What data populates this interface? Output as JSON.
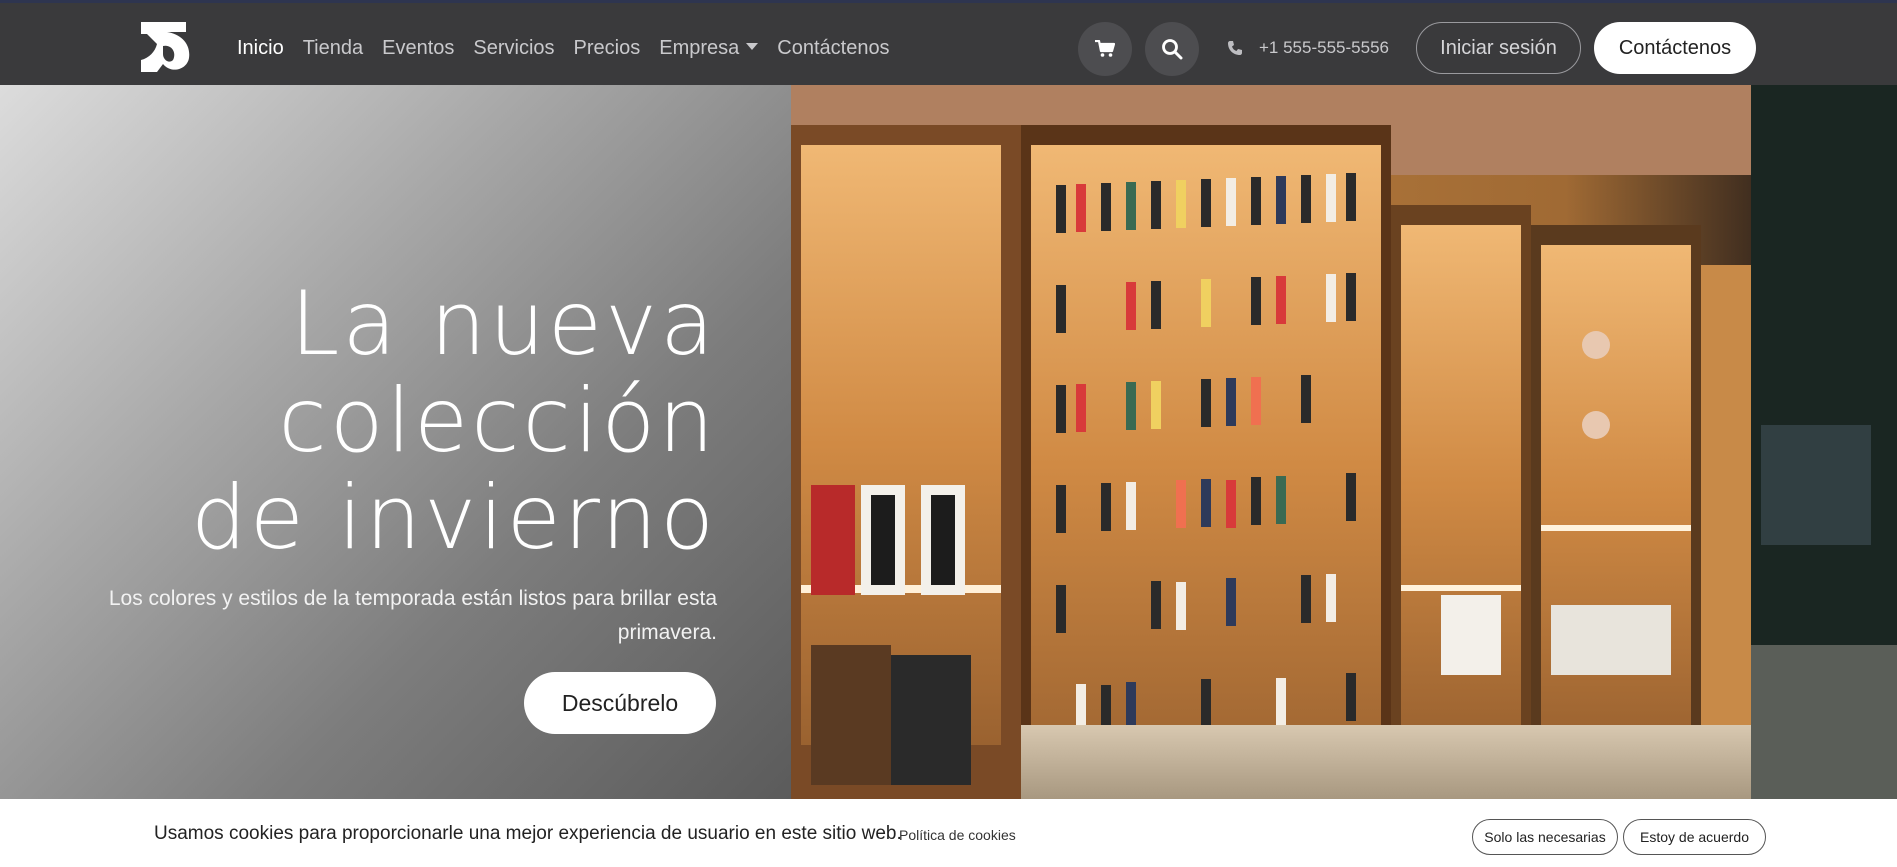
{
  "nav": {
    "links": [
      {
        "label": "Inicio",
        "active": true
      },
      {
        "label": "Tienda"
      },
      {
        "label": "Eventos"
      },
      {
        "label": "Servicios"
      },
      {
        "label": "Precios"
      },
      {
        "label": "Empresa",
        "dropdown": true
      },
      {
        "label": "Contáctenos"
      }
    ],
    "cart_icon": "cart-icon",
    "search_icon": "search-icon",
    "phone_icon": "phone-icon",
    "phone": "+1 555-555-5556",
    "login_label": "Iniciar sesión",
    "contact_label": "Contáctenos"
  },
  "hero": {
    "title_line1": "La nueva",
    "title_line2": "colección",
    "title_line3": "de invierno",
    "subtitle": "Los colores y estilos de la temporada están listos para brillar esta primavera.",
    "cta_label": "Descúbrelo"
  },
  "cookie": {
    "message": "Usamos cookies para proporcionarle una mejor experiencia de usuario en este sitio web.",
    "policy_link": "Política de cookies",
    "necessary_label": "Solo las necesarias",
    "agree_label": "Estoy de acuerdo"
  },
  "colors": {
    "navbar_bg": "#3a3a3c",
    "accent_white": "#ffffff"
  }
}
